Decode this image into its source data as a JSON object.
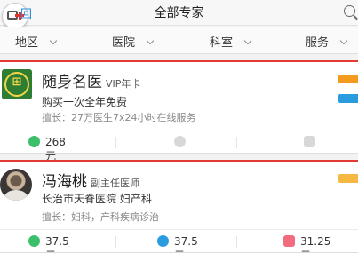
{
  "header": {
    "back_label": "回",
    "title": "全部专家"
  },
  "filters": [
    "地区",
    "医院",
    "科室",
    "服务"
  ],
  "cards": [
    {
      "name": "随身名医",
      "badge": "VIP年卡",
      "line2": "购买一次全年免费",
      "line3": "擅长：27万医生7x24小时在线服务",
      "logo_glyph": "⊞",
      "services": [
        {
          "icon": "chat-icon",
          "color": "#3cbf6a",
          "price": "268元"
        },
        {
          "icon": "phone-icon",
          "color": "#cfcfcf",
          "price": ""
        },
        {
          "icon": "clinic-icon",
          "color": "#cfcfcf",
          "price": ""
        }
      ]
    },
    {
      "name": "冯海桃",
      "badge": "副主任医师",
      "line2": "长治市天脊医院 妇产科",
      "line3": "擅长：妇科，产科疾病诊治",
      "services": [
        {
          "icon": "chat-icon",
          "color": "#3cbf6a",
          "price": "37.5元"
        },
        {
          "icon": "phone-icon",
          "color": "#2b9be0",
          "price": "37.5元"
        },
        {
          "icon": "clinic-icon",
          "color": "#f06c7e",
          "price": "31.25元"
        }
      ]
    }
  ],
  "colors": {
    "accent": "#e53935",
    "link": "#2a8bd8"
  }
}
